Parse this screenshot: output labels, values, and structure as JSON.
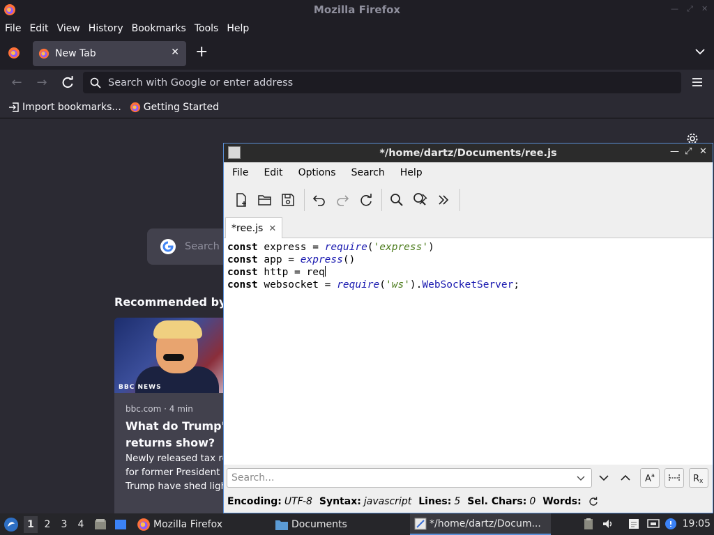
{
  "firefox": {
    "window_title": "Mozilla Firefox",
    "menu": [
      "File",
      "Edit",
      "View",
      "History",
      "Bookmarks",
      "Tools",
      "Help"
    ],
    "tab": {
      "label": "New Tab",
      "close": "✕"
    },
    "new_tab": "+",
    "url_placeholder": "Search with Google or enter address",
    "bookmarks": [
      "Import bookmarks...",
      "Getting Started"
    ],
    "content": {
      "search_placeholder": "Search v",
      "recommended_heading": "Recommended by P",
      "card": {
        "thumb_badge": "BBC NEWS",
        "source": "bbc.com · 4 min",
        "headline_lines": [
          "What do Trump's",
          "returns show?"
        ],
        "excerpt_lines": [
          "Newly released tax ret",
          "for former President D",
          "Trump have shed light"
        ]
      }
    }
  },
  "mousepad": {
    "window_title": "*/home/dartz/Documents/ree.js",
    "menu": [
      "File",
      "Edit",
      "Options",
      "Search",
      "Help"
    ],
    "tab_label": "*ree.js",
    "tab_close": "✕",
    "code": {
      "l1": {
        "kw": "const",
        "t1": " express = ",
        "fn": "require",
        "t2": "(",
        "str": "'express'",
        "t3": ")"
      },
      "l2": {
        "kw": "const",
        "t1": " app = ",
        "fn": "express",
        "t2": "()"
      },
      "l3": {
        "kw": "const",
        "t1": " http = req"
      },
      "l4": {
        "kw": "const",
        "t1": " websocket = ",
        "fn": "require",
        "t2": "(",
        "str": "'ws'",
        "t3": ").",
        "cls": "WebSocketServer",
        "t4": ";"
      }
    },
    "search_placeholder": "Search...",
    "status": {
      "encoding_label": "Encoding:",
      "encoding": "UTF-8",
      "syntax_label": "Syntax:",
      "syntax": "javascript",
      "lines_label": "Lines:",
      "lines": "5",
      "sel_label": "Sel. Chars:",
      "sel": "0",
      "words_label": "Words:"
    }
  },
  "taskbar": {
    "workspaces": [
      "1",
      "2",
      "3",
      "4"
    ],
    "tasks": [
      "Mozilla Firefox",
      "Documents",
      "*/home/dartz/Docum..."
    ],
    "clock": "19:05"
  },
  "colors": {
    "firefox_bg": "#2b2a33",
    "accent": "#5a8fd6",
    "taskbar": "#26262a"
  }
}
